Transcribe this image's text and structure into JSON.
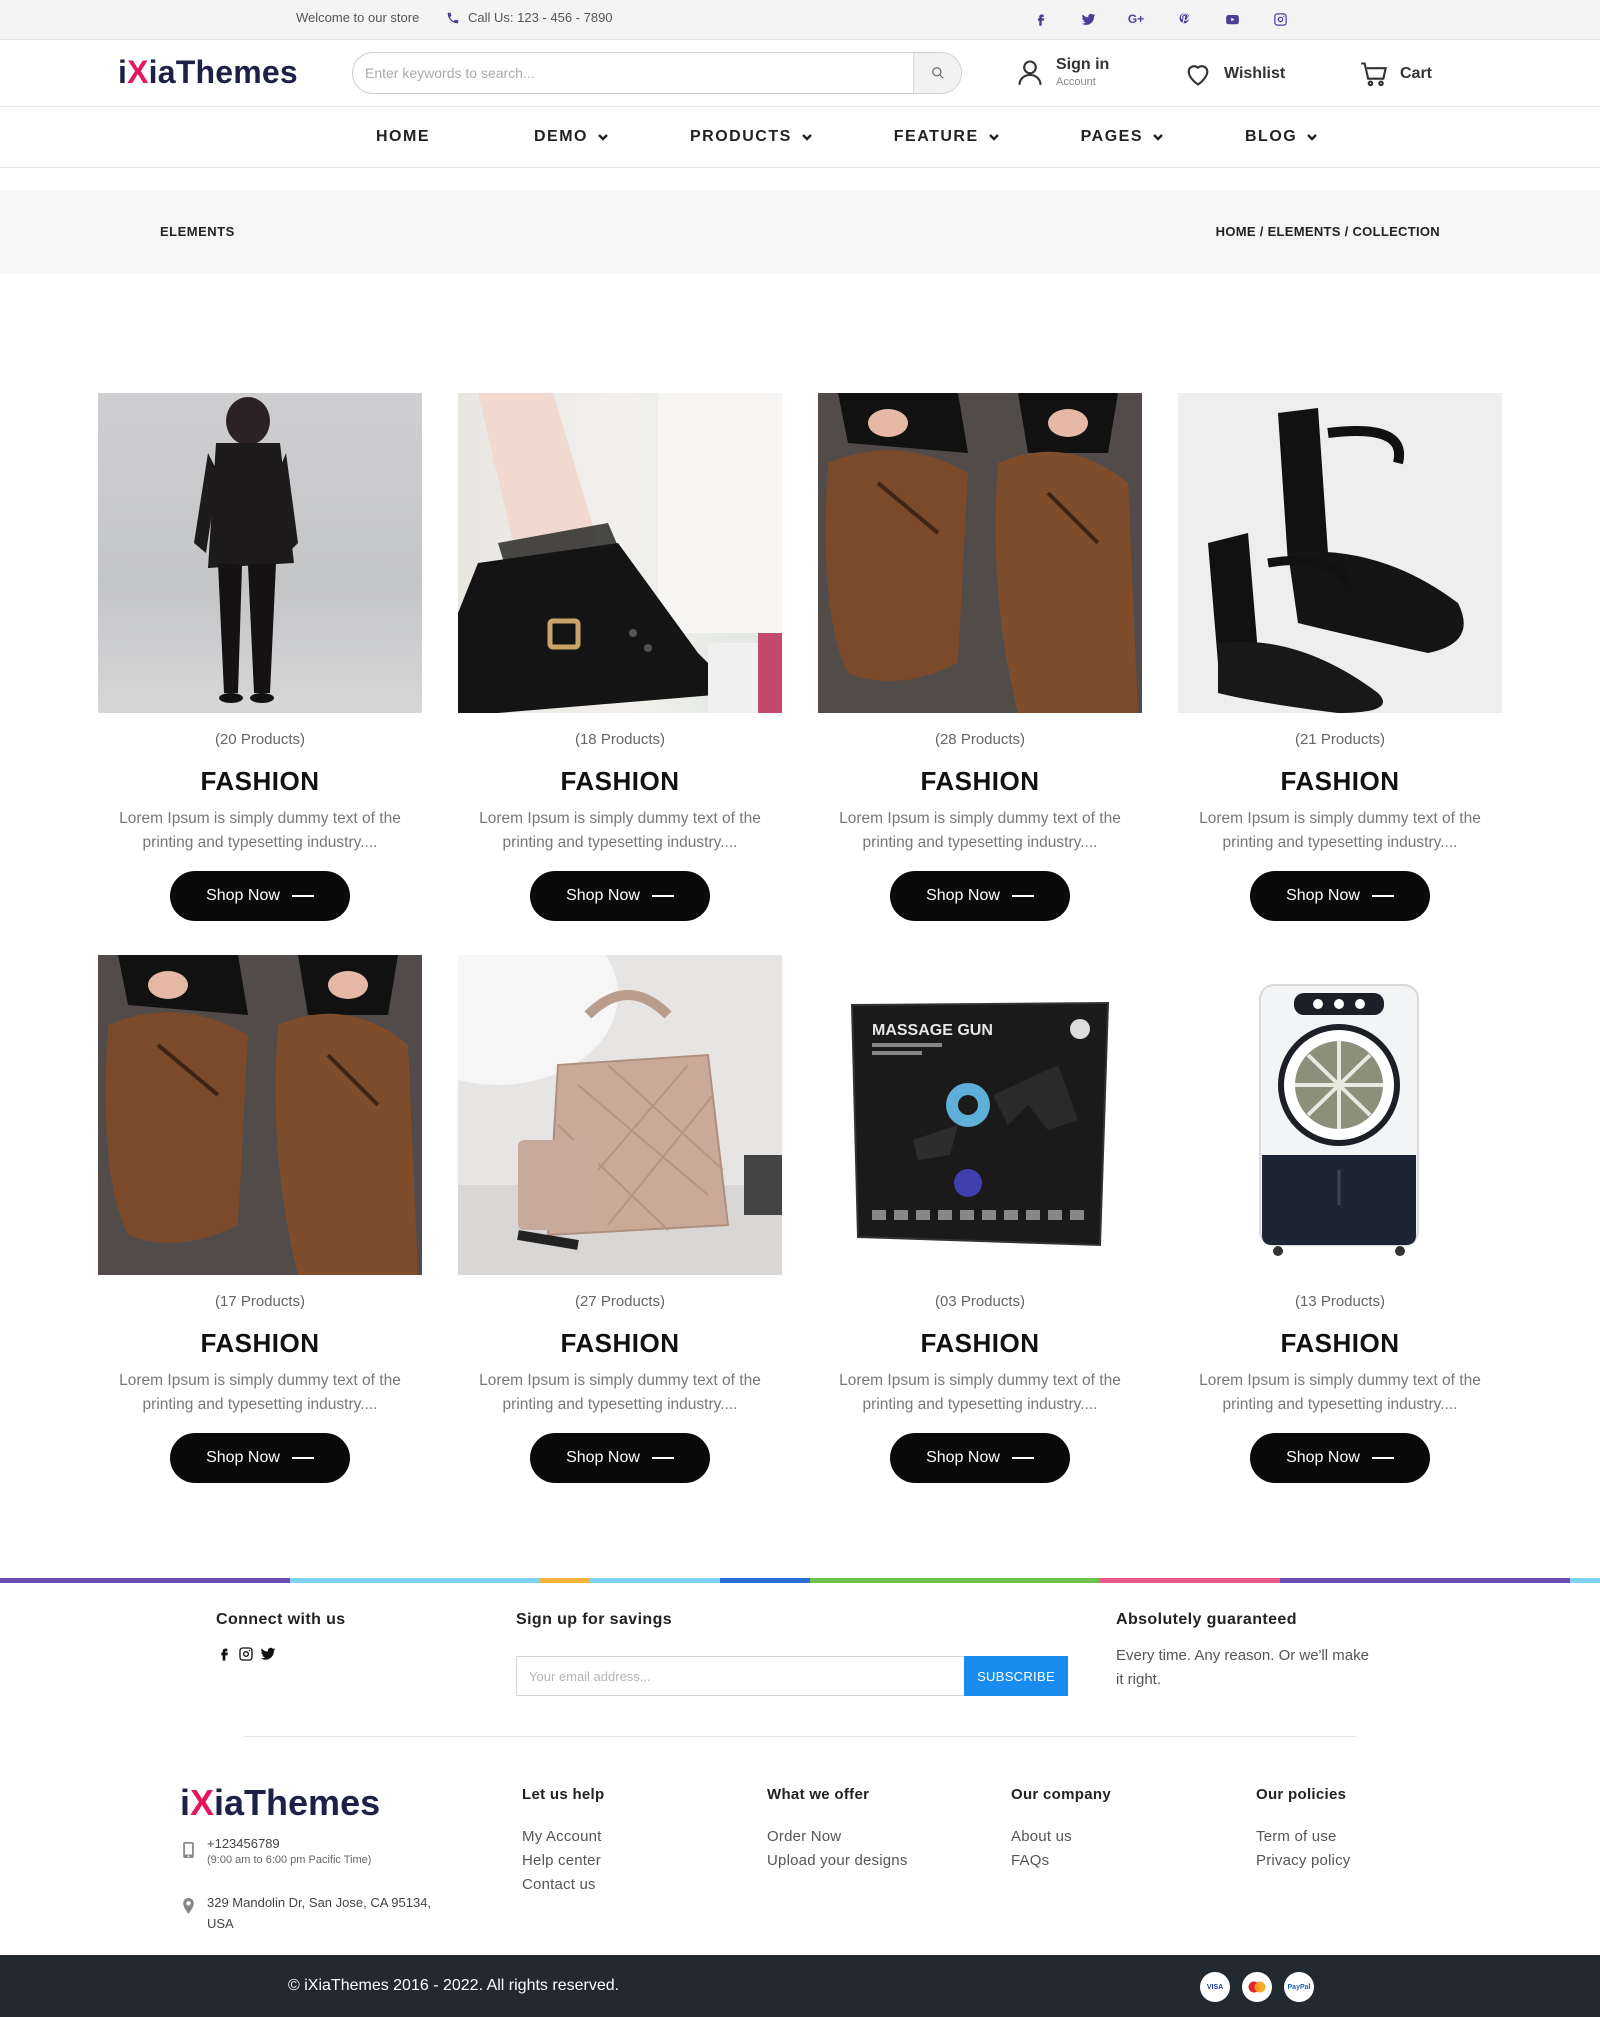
{
  "topbar": {
    "welcome": "Welcome to our store",
    "call": "Call Us: 123 - 456 - 7890",
    "social_icons": [
      "facebook-icon",
      "twitter-icon",
      "google-plus-icon",
      "pinterest-icon",
      "youtube-icon",
      "instagram-icon"
    ],
    "accent_color": "#4b3f9a"
  },
  "header": {
    "logo_prefix": "i",
    "logo_x": "X",
    "logo_suffix": "iaThemes",
    "search_placeholder": "Enter keywords to search...",
    "signin_label": "Sign in",
    "signin_sub": "Account",
    "wishlist_label": "Wishlist",
    "cart_label": "Cart"
  },
  "nav": {
    "items": [
      {
        "label": "HOME",
        "has_dropdown": false
      },
      {
        "label": "DEMO",
        "has_dropdown": true
      },
      {
        "label": "PRODUCTS",
        "has_dropdown": true
      },
      {
        "label": "FEATURE",
        "has_dropdown": true
      },
      {
        "label": "PAGES",
        "has_dropdown": true
      },
      {
        "label": "BLOG",
        "has_dropdown": true
      }
    ]
  },
  "breadcrumb": {
    "page_name": "ELEMENTS",
    "trail": "HOME / ELEMENTS / COLLECTION"
  },
  "collections": [
    {
      "count": "(20 Products)",
      "title": "FASHION",
      "desc": "Lorem Ipsum is simply dummy text of the printing and typesetting industry....",
      "button": "Shop Now",
      "image": "woman-black-suit"
    },
    {
      "count": "(18 Products)",
      "title": "FASHION",
      "desc": "Lorem Ipsum is simply dummy text of the printing and typesetting industry....",
      "button": "Shop Now",
      "image": "black-lace-boot"
    },
    {
      "count": "(28 Products)",
      "title": "FASHION",
      "desc": "Lorem Ipsum is simply dummy text of the printing and typesetting industry....",
      "button": "Shop Now",
      "image": "brown-leather-shoes"
    },
    {
      "count": "(21 Products)",
      "title": "FASHION",
      "desc": "Lorem Ipsum is simply dummy text of the printing and typesetting industry....",
      "button": "Shop Now",
      "image": "black-block-heels"
    },
    {
      "count": "(17 Products)",
      "title": "FASHION",
      "desc": "Lorem Ipsum is simply dummy text of the printing and typesetting industry....",
      "button": "Shop Now",
      "image": "brown-leather-shoes"
    },
    {
      "count": "(27 Products)",
      "title": "FASHION",
      "desc": "Lorem Ipsum is simply dummy text of the printing and typesetting industry....",
      "button": "Shop Now",
      "image": "beige-quilted-handbag"
    },
    {
      "count": "(03 Products)",
      "title": "FASHION",
      "desc": "Lorem Ipsum is simply dummy text of the printing and typesetting industry....",
      "button": "Shop Now",
      "image": "massage-gun-box",
      "image_text": "MASSAGE GUN"
    },
    {
      "count": "(13 Products)",
      "title": "FASHION",
      "desc": "Lorem Ipsum is simply dummy text of the printing and typesetting industry....",
      "button": "Shop Now",
      "image": "air-cooler"
    }
  ],
  "footer": {
    "connect_heading": "Connect with us",
    "connect_icons": [
      "facebook-icon",
      "instagram-icon",
      "twitter-icon"
    ],
    "signup_heading": "Sign up for savings",
    "email_placeholder": "Your email address...",
    "subscribe_label": "SUBSCRIBE",
    "guarantee_heading": "Absolutely guaranteed",
    "guarantee_text": "Every time. Any reason. Or we'll make it right.",
    "phone": "+123456789",
    "hours": "(9:00 am to 6:00 pm Pacific Time)",
    "address": "329 Mandolin Dr, San Jose, CA 95134, USA",
    "columns": [
      {
        "heading": "Let us help",
        "links": [
          "My Account",
          "Help center",
          "Contact us"
        ]
      },
      {
        "heading": "What we offer",
        "links": [
          "Order Now",
          "Upload your designs"
        ]
      },
      {
        "heading": "Our company",
        "links": [
          "About us",
          "FAQs"
        ]
      },
      {
        "heading": "Our policies",
        "links": [
          "Term of use",
          "Privacy policy"
        ]
      }
    ],
    "copyright": "© iXiaThemes 2016 - 2022. All rights reserved.",
    "payment_icons": [
      "visa-icon",
      "mastercard-icon",
      "paypal-icon"
    ],
    "subscribe_color": "#1a8cf0",
    "bottombar_color": "#22292f"
  }
}
